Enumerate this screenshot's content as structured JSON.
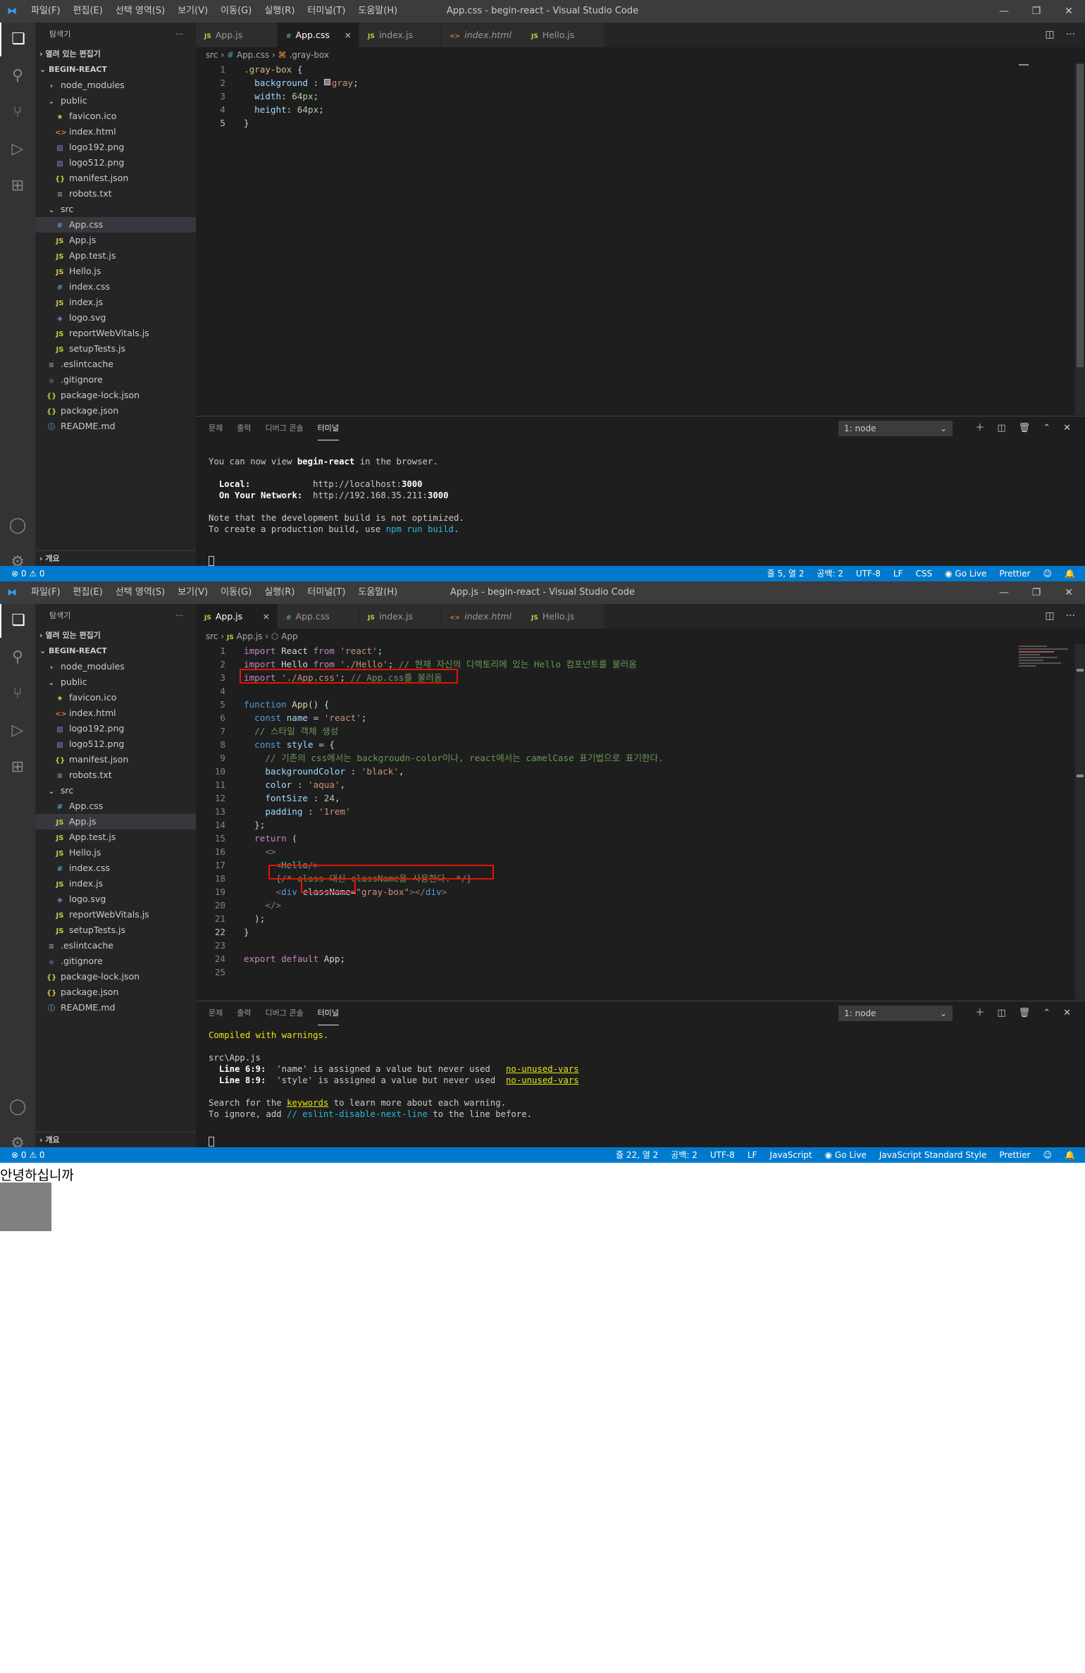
{
  "window1": {
    "title": "App.css - begin-react - Visual Studio Code",
    "menus": [
      "파일(F)",
      "편집(E)",
      "선택 영역(S)",
      "보기(V)",
      "이동(G)",
      "실행(R)",
      "터미널(T)",
      "도움말(H)"
    ],
    "window_controls": [
      "minimize-icon",
      "restore-icon",
      "close-icon"
    ],
    "activity_icons": [
      "explorer-icon",
      "search-icon",
      "source-control-icon",
      "run-debug-icon",
      "extensions-icon",
      "account-icon",
      "settings-gear-icon"
    ],
    "sidebar": {
      "title": "탐색기",
      "more": "···",
      "open_editors": "열려 있는 편집기",
      "project": "BEGIN-REACT",
      "outline": "개요",
      "tree": [
        {
          "label": "node_modules",
          "type": "folder",
          "depth": 1,
          "expanded": false
        },
        {
          "label": "public",
          "type": "folder",
          "depth": 1,
          "expanded": true
        },
        {
          "label": "favicon.ico",
          "type": "ico",
          "depth": 2
        },
        {
          "label": "index.html",
          "type": "html",
          "depth": 2
        },
        {
          "label": "logo192.png",
          "type": "img",
          "depth": 2
        },
        {
          "label": "logo512.png",
          "type": "img",
          "depth": 2
        },
        {
          "label": "manifest.json",
          "type": "json",
          "depth": 2
        },
        {
          "label": "robots.txt",
          "type": "txt",
          "depth": 2
        },
        {
          "label": "src",
          "type": "folder",
          "depth": 1,
          "expanded": true
        },
        {
          "label": "App.css",
          "type": "css",
          "depth": 2,
          "selected": true
        },
        {
          "label": "App.js",
          "type": "js",
          "depth": 2
        },
        {
          "label": "App.test.js",
          "type": "js",
          "depth": 2
        },
        {
          "label": "Hello.js",
          "type": "js",
          "depth": 2
        },
        {
          "label": "index.css",
          "type": "css",
          "depth": 2
        },
        {
          "label": "index.js",
          "type": "js",
          "depth": 2
        },
        {
          "label": "logo.svg",
          "type": "svg",
          "depth": 2
        },
        {
          "label": "reportWebVitals.js",
          "type": "js",
          "depth": 2
        },
        {
          "label": "setupTests.js",
          "type": "js",
          "depth": 2
        },
        {
          "label": ".eslintcache",
          "type": "txt",
          "depth": 1
        },
        {
          "label": ".gitignore",
          "type": "git",
          "depth": 1
        },
        {
          "label": "package-lock.json",
          "type": "json",
          "depth": 1
        },
        {
          "label": "package.json",
          "type": "json",
          "depth": 1
        },
        {
          "label": "README.md",
          "type": "info",
          "depth": 1
        }
      ]
    },
    "tabs": [
      {
        "label": "App.js",
        "type": "js",
        "active": false,
        "italic": false
      },
      {
        "label": "App.css",
        "type": "css",
        "active": true,
        "italic": false,
        "close": "×"
      },
      {
        "label": "index.js",
        "type": "js",
        "active": false,
        "italic": false
      },
      {
        "label": "index.html",
        "type": "html",
        "active": false,
        "italic": true
      },
      {
        "label": "Hello.js",
        "type": "js",
        "active": false,
        "italic": false
      }
    ],
    "breadcrumb": [
      "src",
      "App.css",
      ".gray-box"
    ],
    "code": [
      {
        "n": "1",
        "segs": [
          [
            "sel2",
            ".gray-box"
          ],
          [
            "",
            " {"
          ]
        ]
      },
      {
        "n": "2",
        "segs": [
          [
            "",
            "  "
          ],
          [
            "p",
            "background"
          ],
          [
            "",
            " : "
          ],
          [
            "sw",
            "■"
          ],
          [
            "s",
            "gray"
          ],
          [
            "",
            ";"
          ]
        ]
      },
      {
        "n": "3",
        "segs": [
          [
            "",
            "  "
          ],
          [
            "p",
            "width"
          ],
          [
            "",
            ": "
          ],
          [
            "n",
            "64px"
          ],
          [
            "",
            ";"
          ]
        ]
      },
      {
        "n": "4",
        "segs": [
          [
            "",
            "  "
          ],
          [
            "p",
            "height"
          ],
          [
            "",
            ": "
          ],
          [
            "n",
            "64px"
          ],
          [
            "",
            ";"
          ]
        ]
      },
      {
        "n": "5",
        "segs": [
          [
            "",
            "}"
          ]
        ],
        "current": true
      }
    ],
    "panel": {
      "tabs": [
        "문제",
        "출력",
        "디버그 콘솔",
        "터미널"
      ],
      "active_tab": "터미널",
      "terminal_select": "1: node",
      "terminal_lines": [
        [
          [
            "",
            ""
          ]
        ],
        [
          [
            "",
            "You can now view "
          ],
          [
            "bold",
            "begin-react"
          ],
          [
            "",
            " in the browser."
          ]
        ],
        [
          [
            "",
            ""
          ]
        ],
        [
          [
            "",
            "  "
          ],
          [
            "bold",
            "Local:"
          ],
          [
            "",
            "            http://localhost:"
          ],
          [
            "bold",
            "3000"
          ]
        ],
        [
          [
            "",
            "  "
          ],
          [
            "bold",
            "On Your Network:"
          ],
          [
            "",
            "  http://192.168.35.211:"
          ],
          [
            "bold",
            "3000"
          ]
        ],
        [
          [
            "",
            ""
          ]
        ],
        [
          [
            "",
            "Note that the development build is not optimized."
          ]
        ],
        [
          [
            "",
            "To create a production build, use "
          ],
          [
            "cy",
            "npm run build"
          ],
          [
            "",
            "."
          ]
        ],
        [
          [
            "",
            ""
          ]
        ]
      ]
    },
    "status": {
      "left": "⊗ 0 ⚠ 0",
      "right": [
        "줄 5, 열 2",
        "공백: 2",
        "UTF-8",
        "LF",
        "CSS",
        "Go Live",
        "Prettier",
        "feedback-icon",
        "bell-icon"
      ]
    }
  },
  "window2": {
    "title": "App.js - begin-react - Visual Studio Code",
    "breadcrumb": [
      "src",
      "App.js",
      "App"
    ],
    "tabs": [
      {
        "label": "App.js",
        "type": "js",
        "active": true,
        "italic": false,
        "close": "×"
      },
      {
        "label": "App.css",
        "type": "css",
        "active": false,
        "italic": false
      },
      {
        "label": "index.js",
        "type": "js",
        "active": false,
        "italic": false
      },
      {
        "label": "index.html",
        "type": "html",
        "active": false,
        "italic": true
      },
      {
        "label": "Hello.js",
        "type": "js",
        "active": false,
        "italic": false
      }
    ],
    "selected_file": "App.js",
    "code": [
      {
        "n": "1",
        "segs": [
          [
            "k",
            "import"
          ],
          [
            "",
            " React "
          ],
          [
            "k",
            "from"
          ],
          [
            "",
            " "
          ],
          [
            "s",
            "'react'"
          ],
          [
            "",
            ";"
          ]
        ]
      },
      {
        "n": "2",
        "segs": [
          [
            "k",
            "import"
          ],
          [
            "",
            " Hello "
          ],
          [
            "k",
            "from"
          ],
          [
            "",
            " "
          ],
          [
            "s",
            "'./Hello'"
          ],
          [
            "",
            "; "
          ],
          [
            "cm",
            "// 현재 자신의 디렉토리에 있는 Hello 컴포넌트를 불러옴"
          ]
        ]
      },
      {
        "n": "3",
        "segs": [
          [
            "k",
            "import"
          ],
          [
            "",
            " "
          ],
          [
            "s",
            "'./App.css'"
          ],
          [
            "",
            "; "
          ],
          [
            "cm",
            "// App.css를 불러옴"
          ]
        ]
      },
      {
        "n": "4",
        "segs": [
          [
            "",
            ""
          ]
        ]
      },
      {
        "n": "5",
        "segs": [
          [
            "kw",
            "function"
          ],
          [
            "",
            " "
          ],
          [
            "f",
            "App"
          ],
          [
            "",
            "() {"
          ]
        ]
      },
      {
        "n": "6",
        "segs": [
          [
            "",
            "  "
          ],
          [
            "kw",
            "const"
          ],
          [
            "",
            " "
          ],
          [
            "p",
            "name"
          ],
          [
            "",
            " = "
          ],
          [
            "s",
            "'react'"
          ],
          [
            "",
            ";"
          ]
        ]
      },
      {
        "n": "7",
        "segs": [
          [
            "",
            "  "
          ],
          [
            "cm",
            "// 스타일 객체 생성"
          ]
        ]
      },
      {
        "n": "8",
        "segs": [
          [
            "",
            "  "
          ],
          [
            "kw",
            "const"
          ],
          [
            "",
            " "
          ],
          [
            "p",
            "style"
          ],
          [
            "",
            " = {"
          ]
        ]
      },
      {
        "n": "9",
        "segs": [
          [
            "",
            "    "
          ],
          [
            "cm",
            "// 기존의 css에서는 backgroudn-color이나, react에서는 camelCase 표기법으로 표기한다."
          ]
        ]
      },
      {
        "n": "10",
        "segs": [
          [
            "",
            "    "
          ],
          [
            "p",
            "backgroundColor"
          ],
          [
            "",
            " : "
          ],
          [
            "s",
            "'black'"
          ],
          [
            "",
            ","
          ]
        ]
      },
      {
        "n": "11",
        "segs": [
          [
            "",
            "    "
          ],
          [
            "p",
            "color"
          ],
          [
            "",
            " : "
          ],
          [
            "s",
            "'aqua'"
          ],
          [
            "",
            ","
          ]
        ]
      },
      {
        "n": "12",
        "segs": [
          [
            "",
            "    "
          ],
          [
            "p",
            "fontSize"
          ],
          [
            "",
            " : "
          ],
          [
            "n",
            "24"
          ],
          [
            "",
            ","
          ]
        ]
      },
      {
        "n": "13",
        "segs": [
          [
            "",
            "    "
          ],
          [
            "p",
            "padding"
          ],
          [
            "",
            " : "
          ],
          [
            "s",
            "'1rem'"
          ]
        ]
      },
      {
        "n": "14",
        "segs": [
          [
            "",
            "  };"
          ]
        ]
      },
      {
        "n": "15",
        "segs": [
          [
            "",
            "  "
          ],
          [
            "k",
            "return"
          ],
          [
            "",
            " ("
          ]
        ]
      },
      {
        "n": "16",
        "segs": [
          [
            "",
            "    "
          ],
          [
            "tg",
            "<>"
          ]
        ]
      },
      {
        "n": "17",
        "segs": [
          [
            "",
            "      "
          ],
          [
            "tg",
            "<"
          ],
          [
            "t",
            "Hello"
          ],
          [
            "tg",
            "/>"
          ]
        ]
      },
      {
        "n": "18",
        "segs": [
          [
            "",
            "      "
          ],
          [
            "kw",
            "{"
          ],
          [
            "cm",
            "/* class 대신 className을 사용한다. */"
          ],
          [
            "kw",
            "}"
          ]
        ]
      },
      {
        "n": "19",
        "segs": [
          [
            "",
            "      "
          ],
          [
            "tg",
            "<"
          ],
          [
            "tn",
            "div"
          ],
          [
            "",
            " "
          ],
          [
            "p",
            "className"
          ],
          [
            "",
            "="
          ],
          [
            "s",
            "\"gray-box\""
          ],
          [
            "tg",
            "></"
          ],
          [
            "tn",
            "div"
          ],
          [
            "tg",
            ">"
          ]
        ]
      },
      {
        "n": "20",
        "segs": [
          [
            "",
            "    "
          ],
          [
            "tg",
            "</>"
          ]
        ]
      },
      {
        "n": "21",
        "segs": [
          [
            "",
            "  );"
          ]
        ]
      },
      {
        "n": "22",
        "segs": [
          [
            "",
            "}"
          ]
        ],
        "current": true
      },
      {
        "n": "23",
        "segs": [
          [
            "",
            ""
          ]
        ]
      },
      {
        "n": "24",
        "segs": [
          [
            "k",
            "export"
          ],
          [
            "",
            " "
          ],
          [
            "k",
            "default"
          ],
          [
            "",
            " App;"
          ]
        ]
      },
      {
        "n": "25",
        "segs": [
          [
            "",
            ""
          ]
        ]
      }
    ],
    "terminal_lines": [
      [
        [
          "yl",
          "Compiled with warnings."
        ]
      ],
      [
        [
          "",
          ""
        ]
      ],
      [
        [
          "",
          "src\\App.js"
        ]
      ],
      [
        [
          "",
          "  "
        ],
        [
          "bold",
          "Line 6:9:"
        ],
        [
          "",
          "  'name' is assigned a value but never used   "
        ],
        [
          "yl ul",
          "no-unused-vars"
        ]
      ],
      [
        [
          "",
          "  "
        ],
        [
          "bold",
          "Line 8:9:"
        ],
        [
          "",
          "  'style' is assigned a value but never used  "
        ],
        [
          "yl ul",
          "no-unused-vars"
        ]
      ],
      [
        [
          "",
          ""
        ]
      ],
      [
        [
          "",
          "Search for the "
        ],
        [
          "yl ul",
          "keywords"
        ],
        [
          "",
          " to learn more about each warning."
        ]
      ],
      [
        [
          "",
          "To ignore, add "
        ],
        [
          "cy",
          "// eslint-disable-next-line"
        ],
        [
          "",
          " to the line before."
        ]
      ],
      [
        [
          "",
          ""
        ]
      ],
      [
        [
          "",
          ""
        ]
      ]
    ],
    "status": {
      "left": "⊗ 0 ⚠ 0",
      "right": [
        "줄 22, 열 2",
        "공백: 2",
        "UTF-8",
        "LF",
        "JavaScript",
        "Go Live",
        "JavaScript Standard Style",
        "Prettier",
        "feedback-icon",
        "bell-icon"
      ]
    }
  },
  "rendered_output": {
    "text": "안녕하십니까",
    "box_color": "#808080"
  },
  "colors": {
    "accent": "#007acc",
    "highlight_box": "#e51400"
  }
}
